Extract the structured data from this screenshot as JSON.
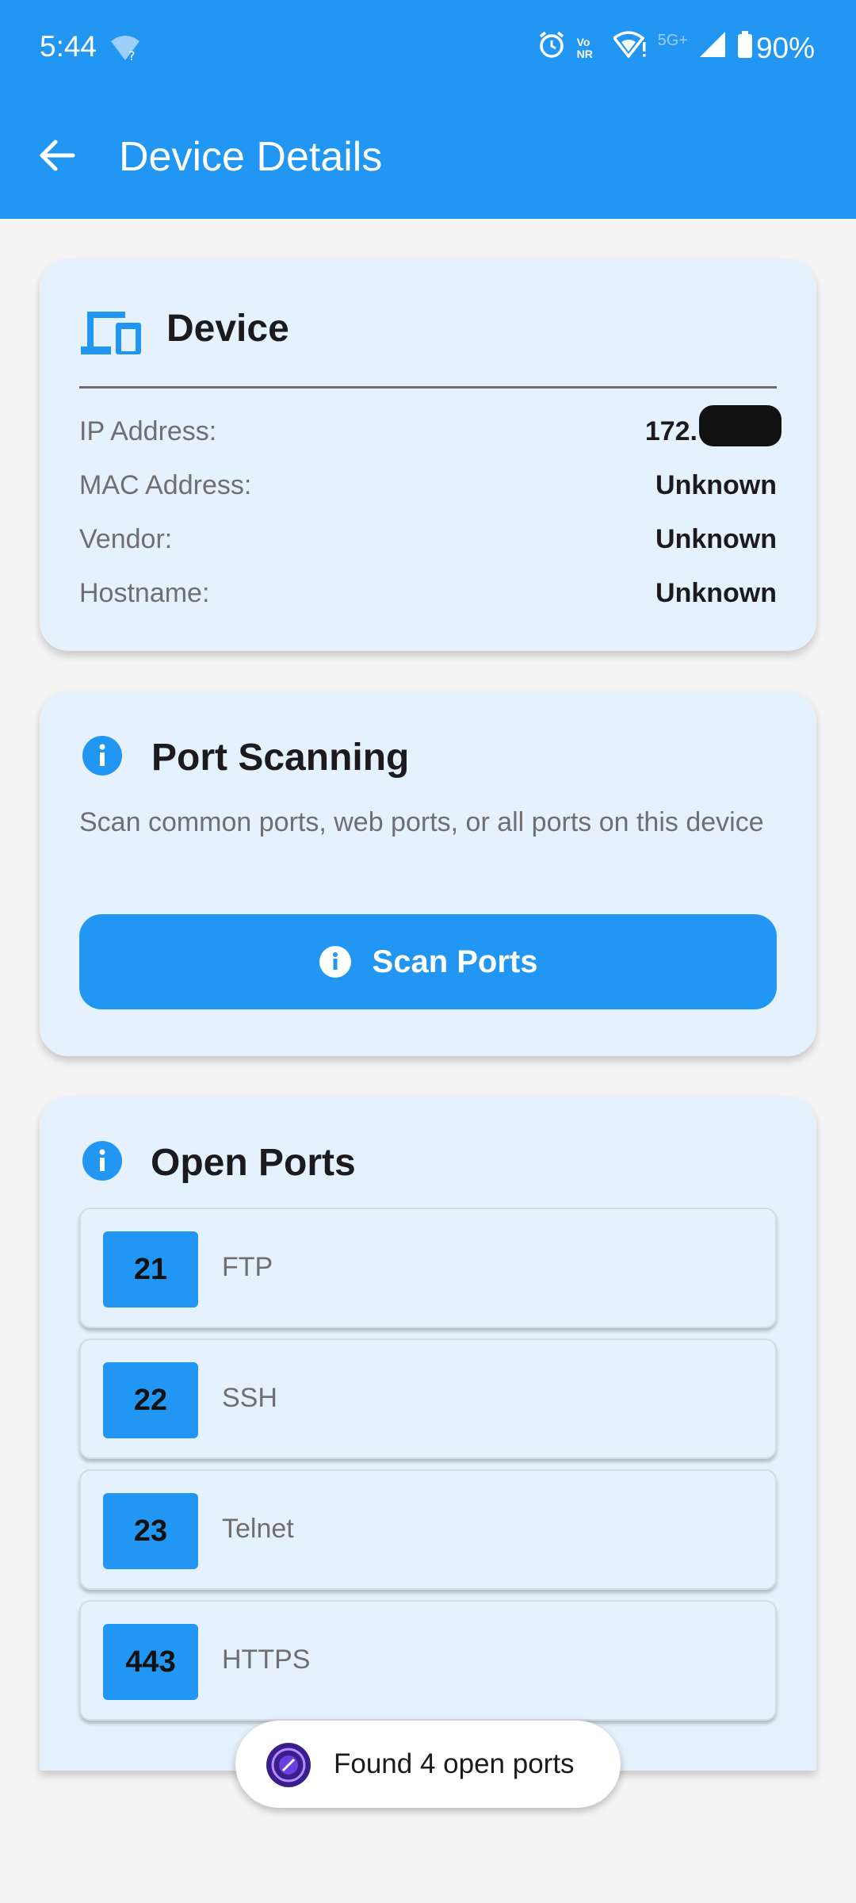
{
  "status_bar": {
    "time": "5:44",
    "network_label": "5G+",
    "volte_label": "Vo NR",
    "battery": "90%"
  },
  "toolbar": {
    "title": "Device Details",
    "back_icon": "arrow-left-icon"
  },
  "device_card": {
    "title": "Device",
    "icon": "devices-icon",
    "rows": [
      {
        "label": "IP Address:",
        "value": "172."
      },
      {
        "label": "MAC Address:",
        "value": "Unknown"
      },
      {
        "label": "Vendor:",
        "value": "Unknown"
      },
      {
        "label": "Hostname:",
        "value": "Unknown"
      }
    ]
  },
  "scan_card": {
    "title": "Port Scanning",
    "description": "Scan common ports, web ports, or all ports on this device",
    "button_label": "Scan Ports",
    "icon": "info-icon"
  },
  "ports_card": {
    "title": "Open Ports",
    "icon": "info-icon",
    "ports": [
      {
        "number": "21",
        "service": "FTP"
      },
      {
        "number": "22",
        "service": "SSH"
      },
      {
        "number": "23",
        "service": "Telnet"
      },
      {
        "number": "443",
        "service": "HTTPS"
      }
    ]
  },
  "toast": {
    "text": "Found 4 open ports"
  },
  "colors": {
    "primary": "#2196F3",
    "card_bg": "#E5F1FC",
    "text_dark": "#1B1B1F",
    "text_muted": "#6F6F73"
  }
}
